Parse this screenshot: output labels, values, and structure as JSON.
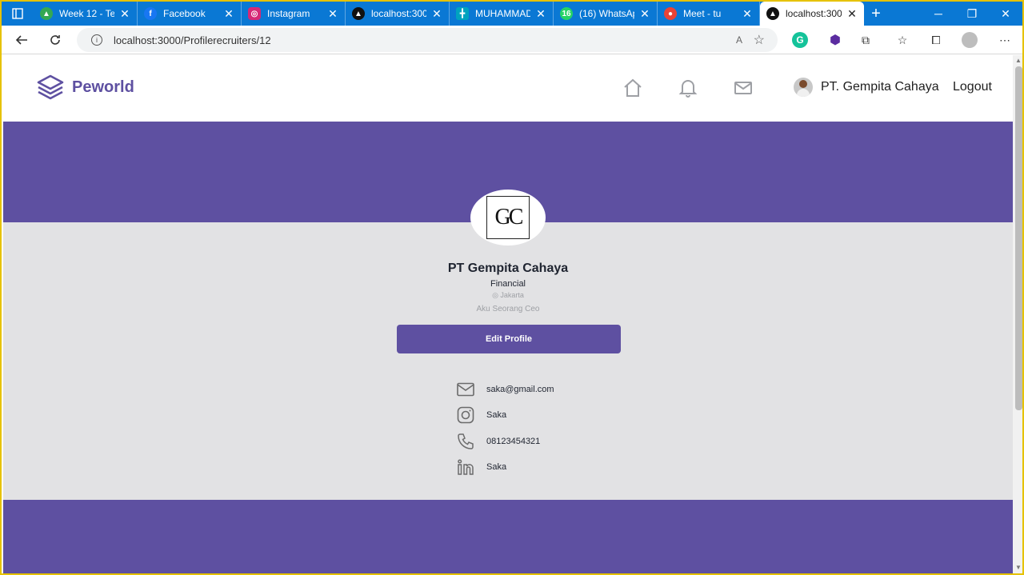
{
  "browser": {
    "tabs": [
      {
        "title": "Week 12 - Tex",
        "icon": "drive-icon",
        "color": "#34a853"
      },
      {
        "title": "Facebook",
        "icon": "facebook-icon",
        "color": "#1877f2"
      },
      {
        "title": "Instagram",
        "icon": "instagram-icon",
        "color": "#d62976"
      },
      {
        "title": "localhost:3000",
        "icon": "next-icon",
        "color": "#111111"
      },
      {
        "title": "MUHAMMAD",
        "icon": "trello-icon",
        "color": "#00a3bf"
      },
      {
        "title": "(16) WhatsApp",
        "icon": "whatsapp-icon",
        "color": "#25d366"
      },
      {
        "title": "Meet - tu",
        "icon": "meet-icon",
        "color": "#ea4335"
      },
      {
        "title": "localhost:3000",
        "icon": "next-icon",
        "color": "#111111"
      }
    ],
    "whatsapp_badge": "16",
    "url": "localhost:3000/Profilerecruiters/12",
    "read_aloud": "A"
  },
  "app": {
    "brand": "Peworld",
    "user_name": "PT. Gempita Cahaya",
    "logout_label": "Logout",
    "colors": {
      "primary": "#5e50a1",
      "background": "#e2e2e4"
    }
  },
  "profile": {
    "logo_text": "GC",
    "company_name": "PT Gempita Cahaya",
    "industry": "Financial",
    "location": "Jakarta",
    "bio": "Aku Seorang Ceo",
    "edit_label": "Edit Profile",
    "contacts": [
      {
        "icon": "mail-icon",
        "value": "saka@gmail.com"
      },
      {
        "icon": "instagram-icon",
        "value": "Saka"
      },
      {
        "icon": "phone-icon",
        "value": "08123454321"
      },
      {
        "icon": "linkedin-icon",
        "value": "Saka"
      }
    ]
  }
}
